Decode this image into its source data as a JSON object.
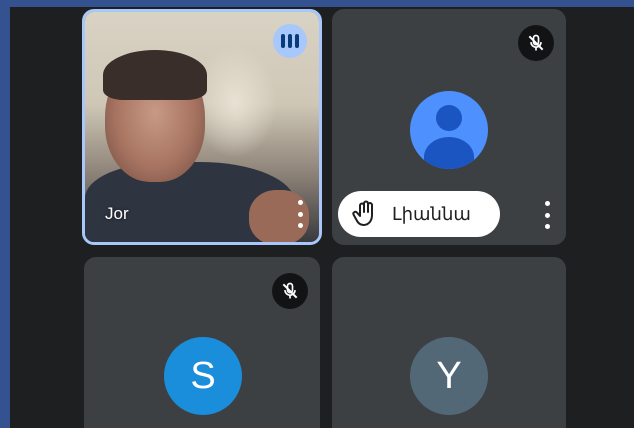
{
  "participants": [
    {
      "name": "Jor",
      "type": "video",
      "speaking": true
    },
    {
      "name": "Լիաննա",
      "type": "avatar",
      "muted": true,
      "hand_raised": true
    },
    {
      "initial": "S",
      "type": "letter",
      "muted": true,
      "color": "#1a8ddb"
    },
    {
      "initial": "Y",
      "type": "letter",
      "color": "#536877"
    }
  ],
  "colors": {
    "frame": "#34528f",
    "stage": "#1e1f20",
    "tile": "#3c4043",
    "speaking_ring": "#a8c7fa"
  },
  "icons": [
    "audio-level-icon",
    "mic-off-icon",
    "raised-hand-icon",
    "more-options-icon",
    "default-avatar-icon"
  ]
}
